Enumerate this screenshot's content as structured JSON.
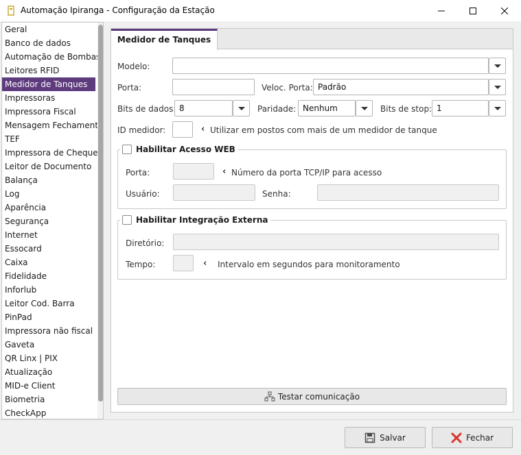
{
  "window": {
    "title": "Automação Ipiranga - Configuração da Estação"
  },
  "sidebar": {
    "items": [
      {
        "label": "Geral"
      },
      {
        "label": "Banco de dados"
      },
      {
        "label": "Automação de Bombas"
      },
      {
        "label": "Leitores RFID"
      },
      {
        "label": "Medidor de Tanques",
        "selected": true
      },
      {
        "label": "Impressoras"
      },
      {
        "label": "Impressora Fiscal"
      },
      {
        "label": "Mensagem Fechamento"
      },
      {
        "label": "TEF"
      },
      {
        "label": "Impressora de Cheque"
      },
      {
        "label": "Leitor de Documento"
      },
      {
        "label": "Balança"
      },
      {
        "label": "Log"
      },
      {
        "label": "Aparência"
      },
      {
        "label": "Segurança"
      },
      {
        "label": "Internet"
      },
      {
        "label": "Essocard"
      },
      {
        "label": "Caixa"
      },
      {
        "label": "Fidelidade"
      },
      {
        "label": "Inforlub"
      },
      {
        "label": "Leitor Cod. Barra"
      },
      {
        "label": "PinPad"
      },
      {
        "label": "Impressora não fiscal"
      },
      {
        "label": "Gaveta"
      },
      {
        "label": "QR Linx | PIX"
      },
      {
        "label": "Atualização"
      },
      {
        "label": "MID-e Client"
      },
      {
        "label": "Biometria"
      },
      {
        "label": "CheckApp"
      }
    ]
  },
  "tab": {
    "label": "Medidor de Tanques"
  },
  "form": {
    "modelo_label": "Modelo:",
    "modelo_value": "",
    "porta_label": "Porta:",
    "porta_value": "",
    "veloc_label": "Veloc. Porta:",
    "veloc_value": "Padrão",
    "bits_dados_label": "Bits de dados:",
    "bits_dados_value": "8",
    "paridade_label": "Paridade:",
    "paridade_value": "Nenhum",
    "bits_stop_label": "Bits de stop:",
    "bits_stop_value": "1",
    "id_medidor_label": "ID medidor:",
    "id_medidor_value": "",
    "id_medidor_hint": "Utilizar em postos com mais de um medidor de tanque"
  },
  "web_group": {
    "title": "Habilitar Acesso WEB",
    "checked": false,
    "porta_label": "Porta:",
    "porta_hint": "Número da porta TCP/IP para acesso",
    "usuario_label": "Usuário:",
    "senha_label": "Senha:"
  },
  "integration_group": {
    "title": "Habilitar Integração Externa",
    "checked": false,
    "diretorio_label": "Diretório:",
    "tempo_label": "Tempo:",
    "tempo_hint": "Intervalo em segundos para monitoramento"
  },
  "actions": {
    "test_label": "Testar comunicação",
    "save_label": "Salvar",
    "close_label": "Fechar"
  },
  "colors": {
    "accent": "#5e3b7d",
    "close_icon": "#d9342b",
    "save_icon": "#4a4a4a"
  }
}
